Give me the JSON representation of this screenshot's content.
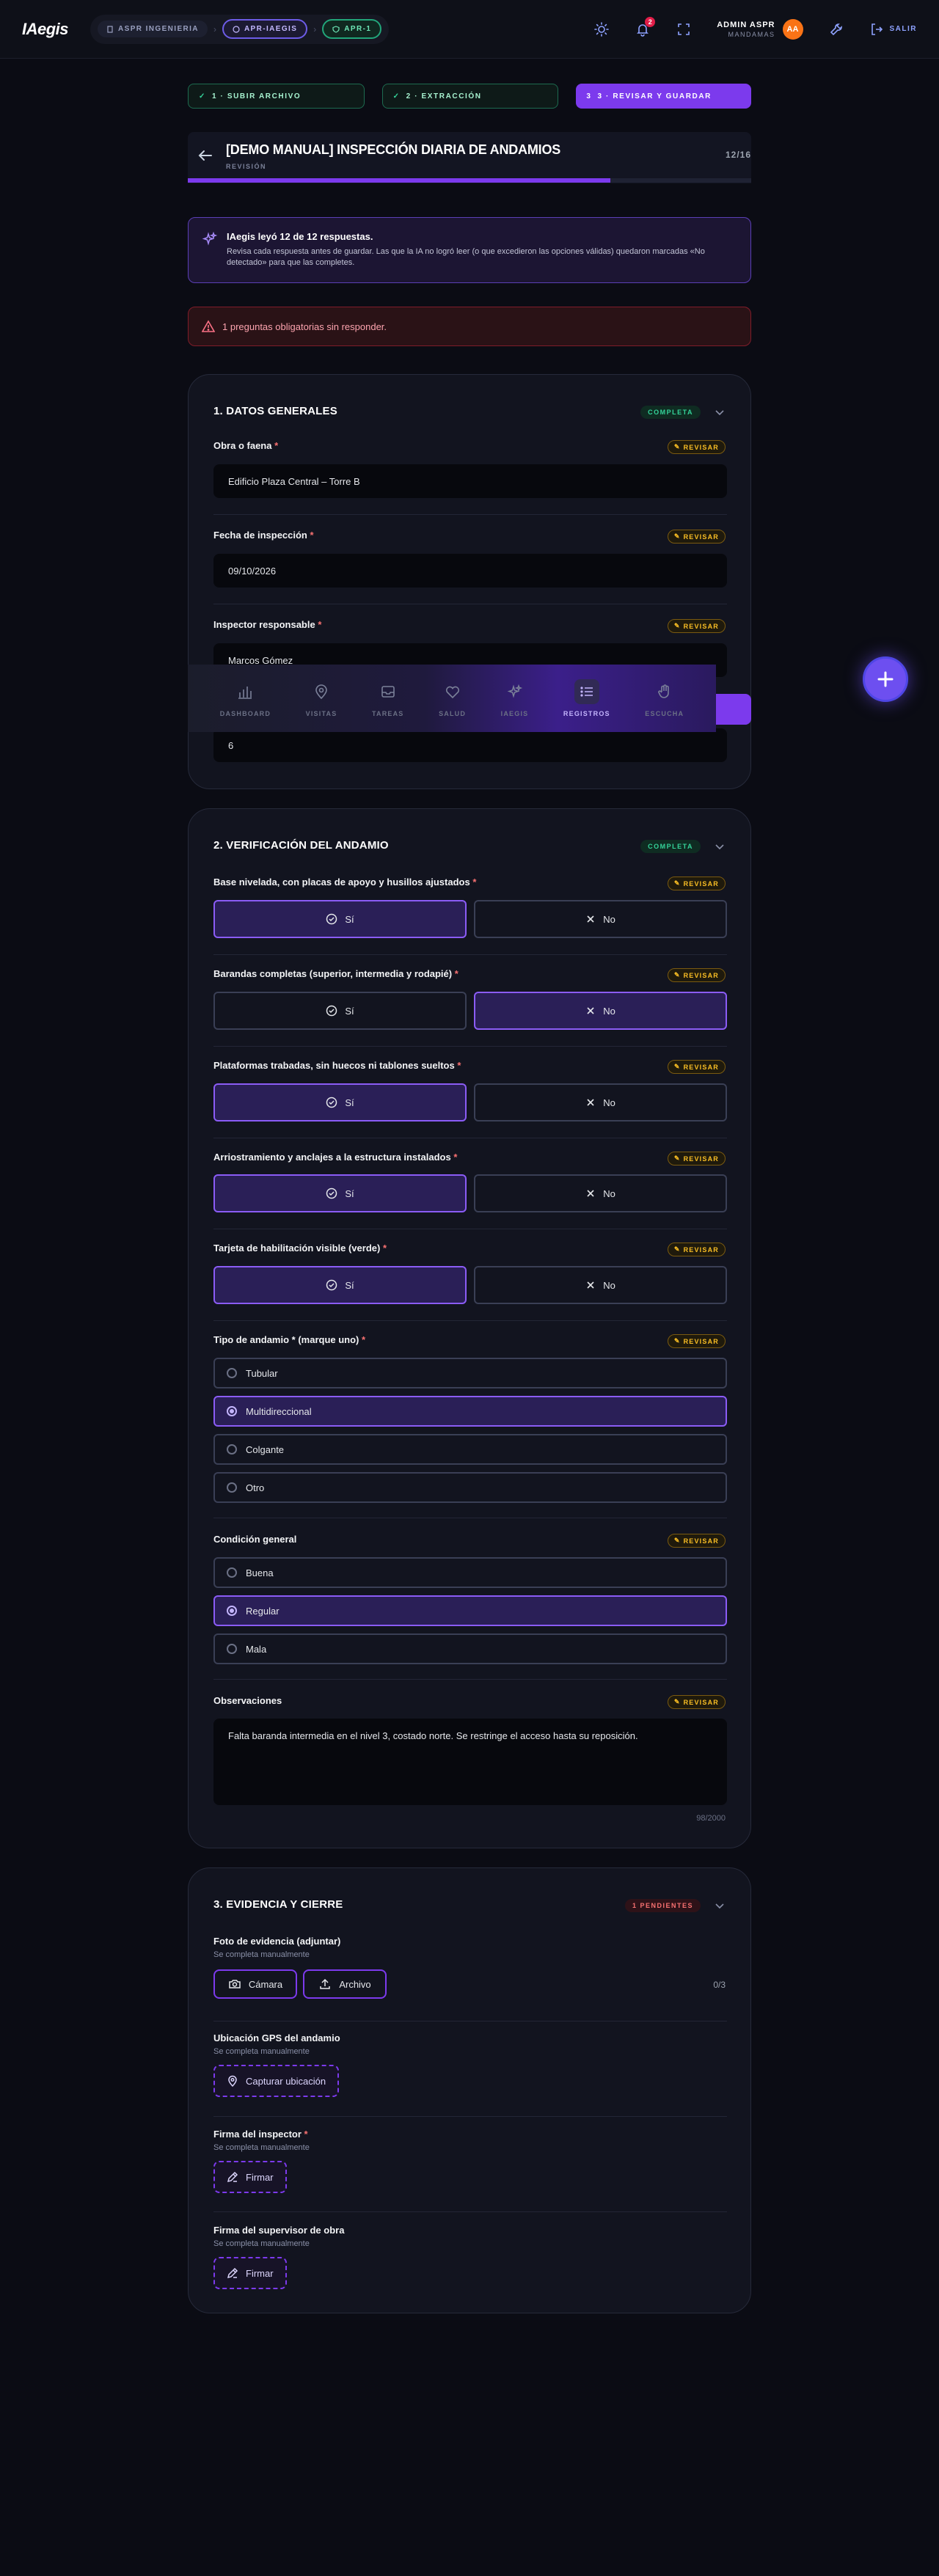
{
  "header": {
    "logo": "IAegis",
    "breadcrumbs": [
      {
        "label": "ASPR INGENIERIA"
      },
      {
        "label": "APR-IAEGIS"
      },
      {
        "label": "APR-1"
      }
    ],
    "notif_count": "2",
    "user_name": "ADMIN ASPR",
    "user_role": "MANDAMAS",
    "avatar": "AA",
    "logout": "SALIR"
  },
  "steps": [
    {
      "label": "1 · SUBIR ARCHIVO"
    },
    {
      "label": "2 · EXTRACCIÓN"
    },
    {
      "label": "3 · REVISAR Y GUARDAR",
      "num": "3"
    }
  ],
  "form": {
    "title": "[DEMO MANUAL] INSPECCIÓN DIARIA DE ANDAMIOS",
    "subtitle": "REVISIÓN",
    "counter": "12/16",
    "progress": 0.75
  },
  "ai_notice": {
    "title": "IAegis leyó 12 de 12 respuestas.",
    "desc": "Revisa cada respuesta antes de guardar. Las que la IA no logró leer (o que excedieron las opciones válidas) quedaron marcadas «No detectado» para que las completes."
  },
  "error": "1 preguntas obligatorias sin responder.",
  "review_label": "REVISAR",
  "yes": "Sí",
  "no": "No",
  "sec1": {
    "title": "1. DATOS GENERALES",
    "badge": "COMPLETA",
    "f1": {
      "label": "Obra o faena",
      "value": "Edificio Plaza Central – Torre B"
    },
    "f2": {
      "label": "Fecha de inspección",
      "value": "09/10/2026"
    },
    "f3": {
      "label": "Inspector responsable",
      "value": "Marcos Gómez"
    },
    "f4": {
      "value": "6"
    }
  },
  "nav": [
    {
      "label": "DASHBOARD"
    },
    {
      "label": "VISITAS"
    },
    {
      "label": "TAREAS"
    },
    {
      "label": "SALUD"
    },
    {
      "label": "IAEGIS"
    },
    {
      "label": "REGISTROS"
    },
    {
      "label": "ESCUCHA"
    }
  ],
  "sec2": {
    "title": "2. VERIFICACIÓN DEL ANDAMIO",
    "badge": "COMPLETA",
    "q1": "Base nivelada, con placas de apoyo y husillos ajustados",
    "q2": "Barandas completas (superior, intermedia y rodapié)",
    "q3": "Plataformas trabadas, sin huecos ni tablones sueltos",
    "q4": "Arriostramiento y anclajes a la estructura instalados",
    "q5": "Tarjeta de habilitación visible (verde)",
    "q6": {
      "label": "Tipo de andamio * (marque uno)",
      "options": [
        "Tubular",
        "Multidireccional",
        "Colgante",
        "Otro"
      ],
      "selected": "Multidireccional"
    },
    "q7": {
      "label": "Condición general",
      "options": [
        "Buena",
        "Regular",
        "Mala"
      ],
      "selected": "Regular"
    },
    "q8": {
      "label": "Observaciones",
      "value": "Falta baranda intermedia en el nivel 3, costado norte. Se restringe el acceso hasta su reposición.",
      "count": "98/2000"
    }
  },
  "sec3": {
    "title": "3. EVIDENCIA Y CIERRE",
    "badge": "1 PENDIENTES",
    "manual": "Se completa manualmente",
    "photo": {
      "label": "Foto de evidencia (adjuntar)",
      "camera": "Cámara",
      "file": "Archivo",
      "count": "0/3"
    },
    "gps": {
      "label": "Ubicación GPS del andamio",
      "btn": "Capturar ubicación"
    },
    "sign1": {
      "label": "Firma del inspector",
      "btn": "Firmar"
    },
    "sign2": {
      "label": "Firma del supervisor de obra",
      "btn": "Firmar"
    }
  }
}
